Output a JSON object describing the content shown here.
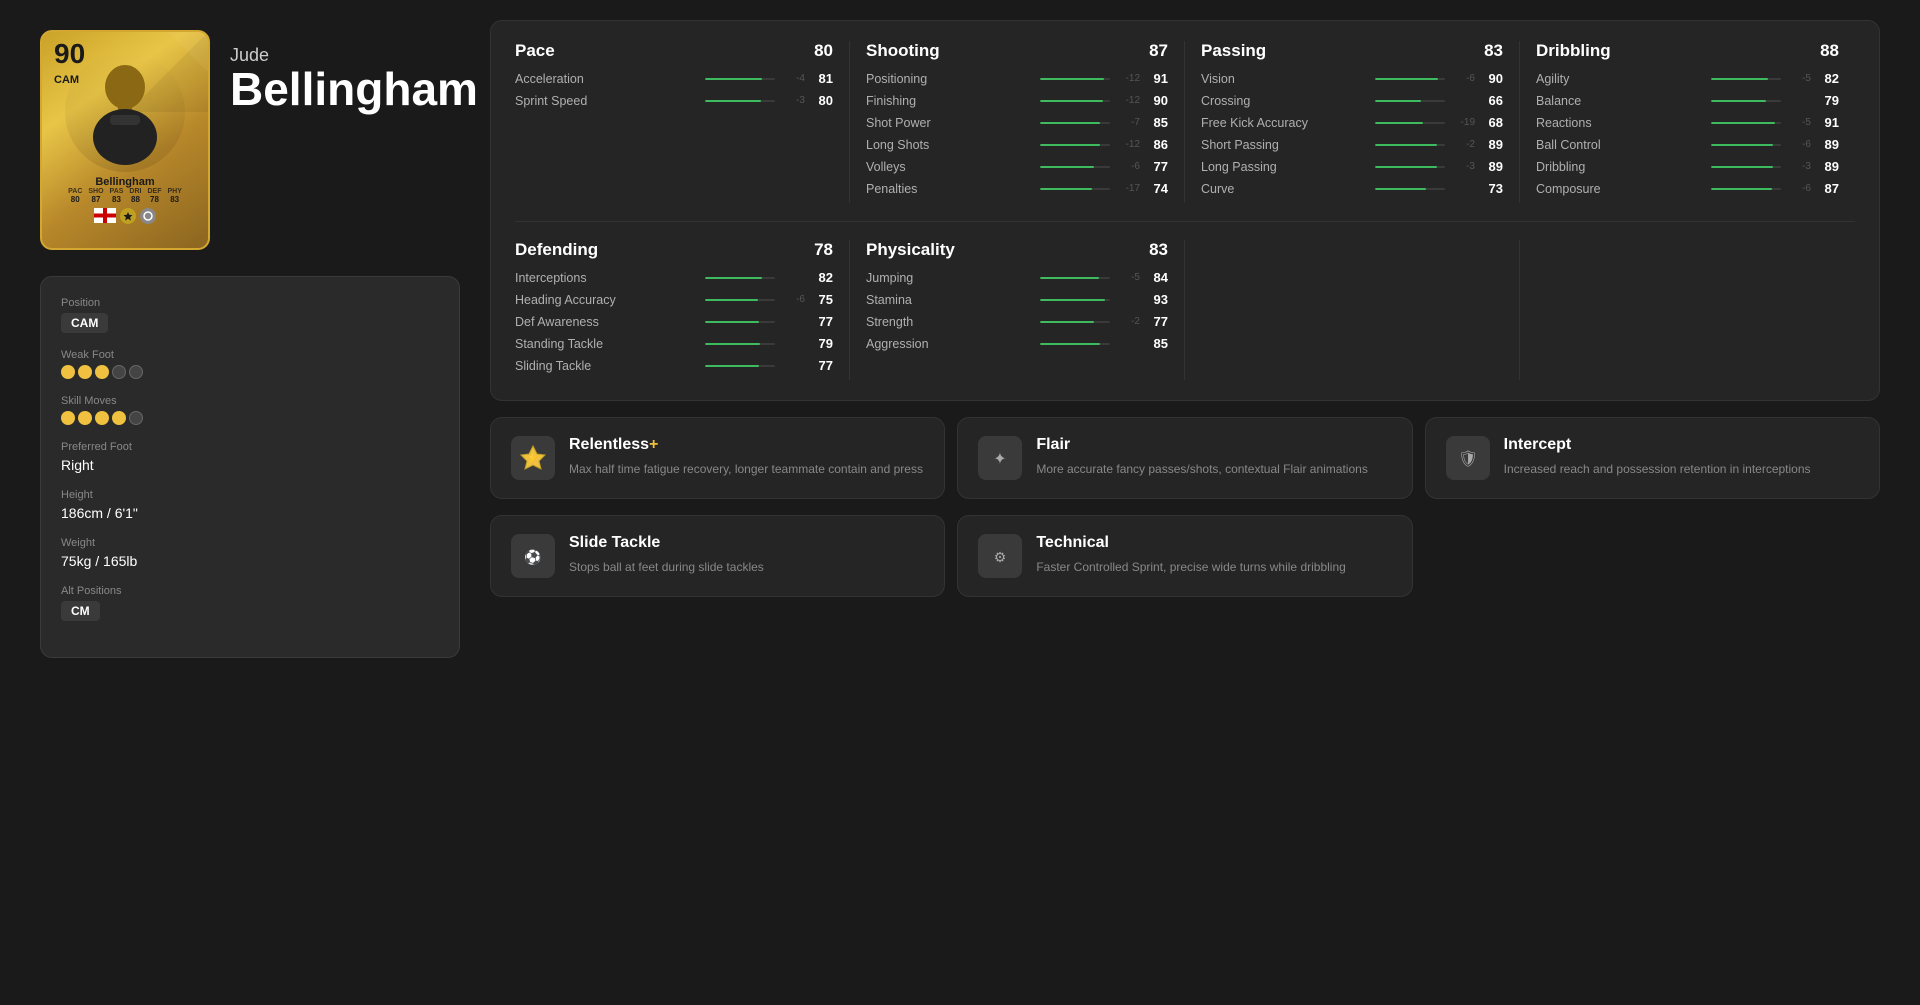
{
  "player": {
    "first_name": "Jude",
    "last_name": "Bellingham",
    "rating": "90",
    "position": "CAM",
    "card_name": "Bellingham",
    "card_stats": {
      "pac": {
        "label": "PAC",
        "value": "80"
      },
      "sho": {
        "label": "SHO",
        "value": "87"
      },
      "pas": {
        "label": "PAS",
        "value": "83"
      },
      "dri": {
        "label": "DRI",
        "value": "88"
      },
      "def": {
        "label": "DEF",
        "value": "78"
      },
      "phy": {
        "label": "PHY",
        "value": "83"
      }
    }
  },
  "player_info": {
    "position_label": "Position",
    "position_value": "CAM",
    "weak_foot_label": "Weak Foot",
    "weak_foot_stars": 3,
    "weak_foot_total": 5,
    "skill_moves_label": "Skill Moves",
    "skill_moves_stars": 4,
    "skill_moves_total": 5,
    "preferred_foot_label": "Preferred Foot",
    "preferred_foot_value": "Right",
    "height_label": "Height",
    "height_value": "186cm / 6'1\"",
    "weight_label": "Weight",
    "weight_value": "75kg / 165lb",
    "alt_positions_label": "Alt Positions",
    "alt_positions": [
      "CM"
    ]
  },
  "stats": {
    "pace": {
      "name": "Pace",
      "score": 80,
      "attributes": [
        {
          "name": "Acceleration",
          "value": 81,
          "delta": "-4",
          "pct": 81
        },
        {
          "name": "Sprint Speed",
          "value": 80,
          "delta": "-3",
          "pct": 80
        }
      ]
    },
    "shooting": {
      "name": "Shooting",
      "score": 87,
      "attributes": [
        {
          "name": "Positioning",
          "value": 91,
          "delta": "-12",
          "pct": 91
        },
        {
          "name": "Finishing",
          "value": 90,
          "delta": "-12",
          "pct": 90
        },
        {
          "name": "Shot Power",
          "value": 85,
          "delta": "-7",
          "pct": 85
        },
        {
          "name": "Long Shots",
          "value": 86,
          "delta": "-12",
          "pct": 86
        },
        {
          "name": "Volleys",
          "value": 77,
          "delta": "-6",
          "pct": 77
        },
        {
          "name": "Penalties",
          "value": 74,
          "delta": "-17",
          "pct": 74
        }
      ]
    },
    "passing": {
      "name": "Passing",
      "score": 83,
      "attributes": [
        {
          "name": "Vision",
          "value": 90,
          "delta": "-6",
          "pct": 90
        },
        {
          "name": "Crossing",
          "value": 66,
          "delta": "",
          "pct": 66
        },
        {
          "name": "Free Kick Accuracy",
          "value": 68,
          "delta": "-19",
          "pct": 68
        },
        {
          "name": "Short Passing",
          "value": 89,
          "delta": "-2",
          "pct": 89
        },
        {
          "name": "Long Passing",
          "value": 89,
          "delta": "-3",
          "pct": 89
        },
        {
          "name": "Curve",
          "value": 73,
          "delta": "",
          "pct": 73
        }
      ]
    },
    "dribbling": {
      "name": "Dribbling",
      "score": 88,
      "attributes": [
        {
          "name": "Agility",
          "value": 82,
          "delta": "-5",
          "pct": 82
        },
        {
          "name": "Balance",
          "value": 79,
          "delta": "",
          "pct": 79
        },
        {
          "name": "Reactions",
          "value": 91,
          "delta": "-5",
          "pct": 91
        },
        {
          "name": "Ball Control",
          "value": 89,
          "delta": "-6",
          "pct": 89
        },
        {
          "name": "Dribbling",
          "value": 89,
          "delta": "-3",
          "pct": 89
        },
        {
          "name": "Composure",
          "value": 87,
          "delta": "-6",
          "pct": 87
        }
      ]
    },
    "defending": {
      "name": "Defending",
      "score": 78,
      "attributes": [
        {
          "name": "Interceptions",
          "value": 82,
          "delta": "",
          "pct": 82
        },
        {
          "name": "Heading Accuracy",
          "value": 75,
          "delta": "-6",
          "pct": 75
        },
        {
          "name": "Def Awareness",
          "value": 77,
          "delta": "",
          "pct": 77
        },
        {
          "name": "Standing Tackle",
          "value": 79,
          "delta": "",
          "pct": 79
        },
        {
          "name": "Sliding Tackle",
          "value": 77,
          "delta": "",
          "pct": 77
        }
      ]
    },
    "physicality": {
      "name": "Physicality",
      "score": 83,
      "attributes": [
        {
          "name": "Jumping",
          "value": 84,
          "delta": "-5",
          "pct": 84
        },
        {
          "name": "Stamina",
          "value": 93,
          "delta": "",
          "pct": 93
        },
        {
          "name": "Strength",
          "value": 77,
          "delta": "-2",
          "pct": 77
        },
        {
          "name": "Aggression",
          "value": 85,
          "delta": "",
          "pct": 85
        }
      ]
    }
  },
  "playstyles": [
    {
      "id": "relentless",
      "name": "Relentless+",
      "is_plus": true,
      "icon": "⚡",
      "desc": "Max half time fatigue recovery, longer teammate contain and press"
    },
    {
      "id": "flair",
      "name": "Flair",
      "is_plus": false,
      "icon": "✦",
      "desc": "More accurate fancy passes/shots, contextual Flair animations"
    },
    {
      "id": "intercept",
      "name": "Intercept",
      "is_plus": false,
      "icon": "🛡",
      "desc": "Increased reach and possession retention in interceptions"
    },
    {
      "id": "slide_tackle",
      "name": "Slide Tackle",
      "is_plus": false,
      "icon": "⚽",
      "desc": "Stops ball at feet during slide tackles"
    },
    {
      "id": "technical",
      "name": "Technical",
      "is_plus": false,
      "icon": "⚙",
      "desc": "Faster Controlled Sprint, precise wide turns while dribbling"
    }
  ]
}
